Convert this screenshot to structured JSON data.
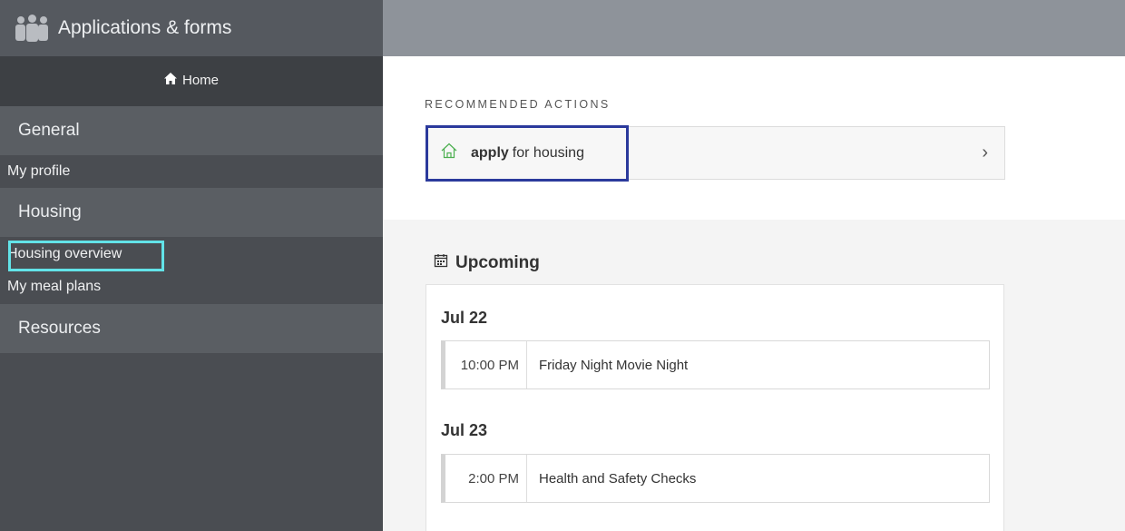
{
  "sidebar": {
    "title": "Applications & forms",
    "home_label": "Home",
    "sections": [
      {
        "label": "General",
        "items": [
          "My profile"
        ]
      },
      {
        "label": "Housing",
        "items": [
          "Housing overview",
          "My meal plans"
        ]
      },
      {
        "label": "Resources",
        "items": []
      }
    ]
  },
  "recommended": {
    "heading": "RECOMMENDED ACTIONS",
    "action_bold": "apply",
    "action_rest": "for housing"
  },
  "upcoming": {
    "title": "Upcoming",
    "groups": [
      {
        "date": "Jul 22",
        "time": "10:00 PM",
        "name": "Friday Night Movie Night"
      },
      {
        "date": "Jul 23",
        "time": "2:00 PM",
        "name": "Health and Safety Checks"
      }
    ]
  },
  "icons": {
    "app": "users-icon",
    "home": "home-icon",
    "house": "house-outline-icon",
    "calendar": "calendar-icon",
    "chevron": "chevron-right-icon"
  },
  "colors": {
    "sidebar_bg": "#4a4d52",
    "highlight_cyan": "#62e3e8",
    "highlight_blue": "#2b3a9c"
  }
}
